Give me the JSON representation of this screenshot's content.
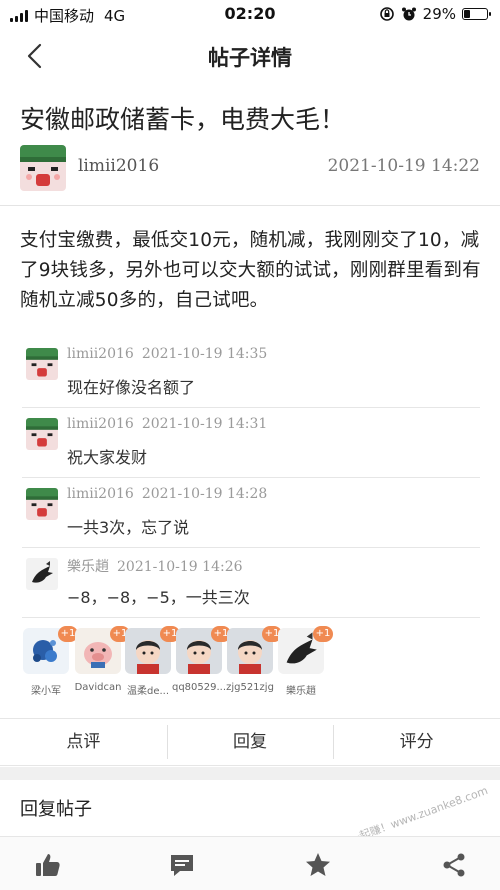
{
  "status_bar": {
    "carrier": "中国移动",
    "network": "4G",
    "time": "02:20",
    "battery": "29%",
    "battery_level": 0.29
  },
  "nav": {
    "title": "帖子详情"
  },
  "post": {
    "title": "安徽邮政储蓄卡，电费大毛！",
    "author": "limii2016",
    "time": "2021-10-19 14:22",
    "body": "支付宝缴费，最低交10元，随机减，我刚刚交了10，减了9块钱多，另外也可以交大额的试试，刚刚群里看到有随机立减50多的，自己试吧。"
  },
  "comments": [
    {
      "user": "limii2016",
      "time": "2021-10-19 14:35",
      "text": "现在好像没名额了",
      "avatar": "cartoon-avatar"
    },
    {
      "user": "limii2016",
      "time": "2021-10-19 14:31",
      "text": "祝大家发财",
      "avatar": "cartoon-avatar"
    },
    {
      "user": "limii2016",
      "time": "2021-10-19 14:28",
      "text": "一共3次，忘了说",
      "avatar": "cartoon-avatar"
    },
    {
      "user": "樂乐趙",
      "time": "2021-10-19 14:26",
      "text": "−8，−8，−5，一共三次",
      "avatar": "bird-avatar"
    }
  ],
  "raters": [
    {
      "name": "梁小军",
      "badge": "+1"
    },
    {
      "name": "Davidcan",
      "badge": "+1"
    },
    {
      "name": "温柔de...",
      "badge": "+1"
    },
    {
      "name": "qq80529...",
      "badge": "+1"
    },
    {
      "name": "zjg521zjg",
      "badge": "+1"
    },
    {
      "name": "樂乐趙",
      "badge": "+1"
    }
  ],
  "actions": {
    "rate": "点评",
    "reply": "回复",
    "score": "评分"
  },
  "reply_section": {
    "label": "回复帖子"
  },
  "toolbar": {
    "icons": [
      "thumbs-up-icon",
      "comment-icon",
      "star-icon",
      "share-icon"
    ]
  },
  "watermark": "赚客吧，有奖一起赚！www.zuanke8.com",
  "colors": {
    "badge": "#f08a52",
    "muted_text": "#9a9a9a",
    "icon": "#555555"
  }
}
